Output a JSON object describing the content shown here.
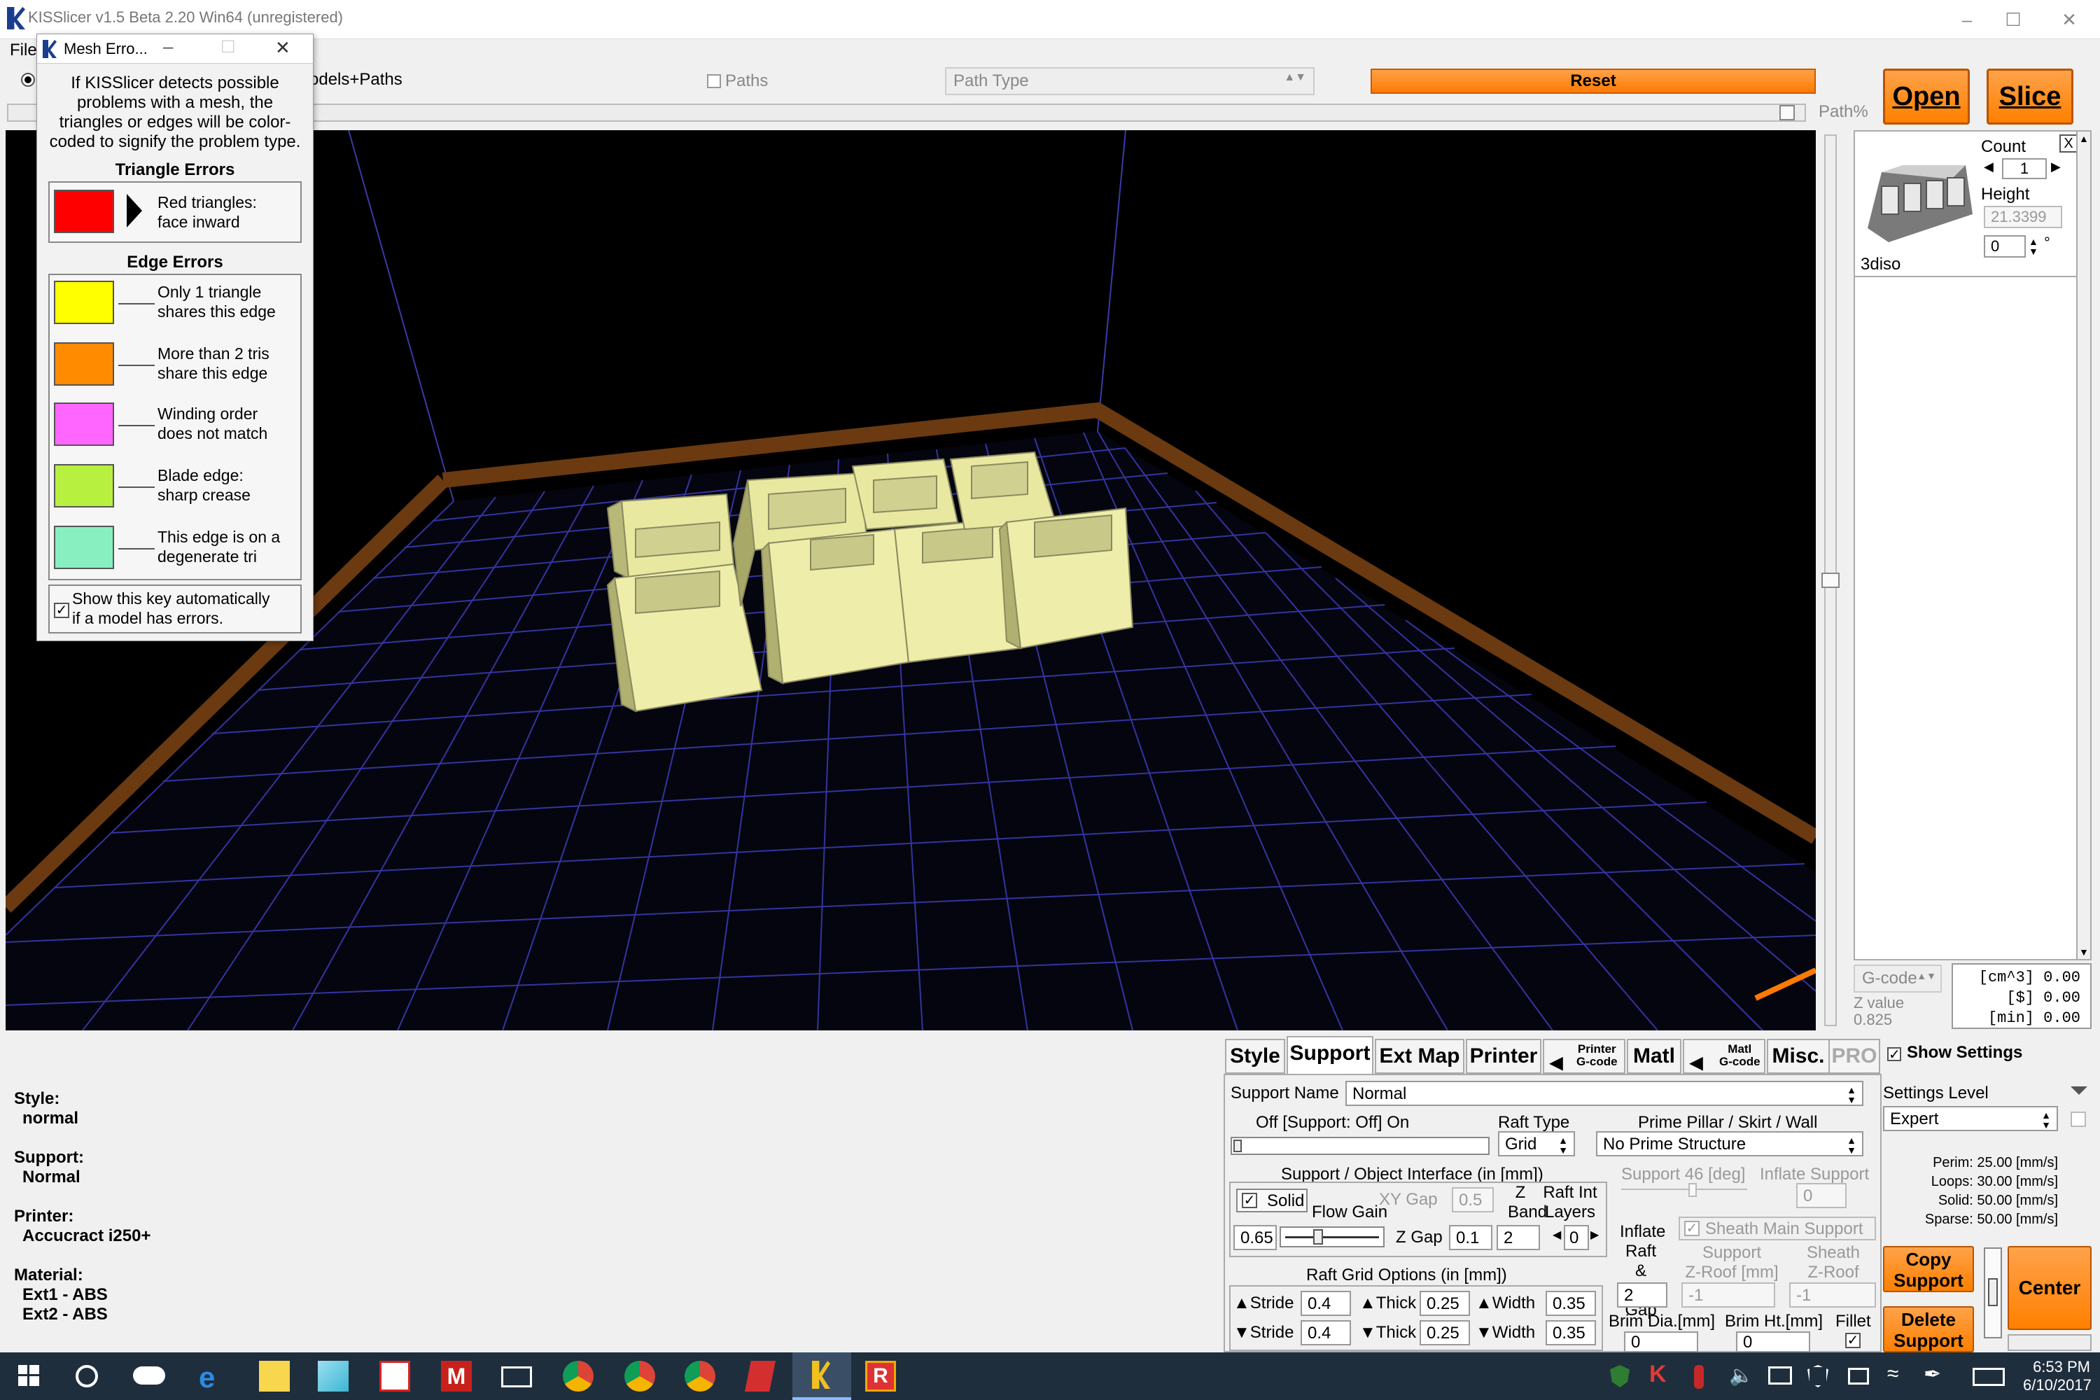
{
  "window": {
    "title": "KISSlicer v1.5 Beta 2.20 Win64 (unregistered)"
  },
  "menu": {
    "file": "File"
  },
  "toolbar": {
    "models_paths": "odels+Paths",
    "paths_label": "Paths",
    "path_type": "Path Type",
    "reset": "Reset",
    "path_pct": "Path%",
    "open": "Open",
    "slice": "Slice"
  },
  "mesh_dialog": {
    "title": "Mesh Erro...",
    "intro": [
      "If KISSlicer detects possible",
      "problems with a mesh, the",
      "triangles or edges will be color-",
      "coded to signify the problem type."
    ],
    "triangle_errors_title": "Triangle Errors",
    "edge_errors_title": "Edge Errors",
    "items": [
      {
        "color": "#ff0000",
        "l1": "Red triangles:",
        "l2": "face inward"
      },
      {
        "color": "#ffff00",
        "l1": "Only 1 triangle",
        "l2": "shares this edge"
      },
      {
        "color": "#ff8c00",
        "l1": "More than 2 tris",
        "l2": "share this edge"
      },
      {
        "color": "#ff66ff",
        "l1": "Winding order",
        "l2": "does not match"
      },
      {
        "color": "#b8f040",
        "l1": "Blade edge:",
        "l2": "sharp crease"
      },
      {
        "color": "#88f0c0",
        "l1": "This edge is on a",
        "l2": "degenerate tri"
      }
    ],
    "show_key_l1": "Show this key automatically",
    "show_key_l2": "if a model has errors."
  },
  "model_panel": {
    "count_label": "Count",
    "count_value": "1",
    "height_label": "Height",
    "height_value": "21.3399",
    "rotation_value": "0",
    "deg": "°",
    "model_name": "3diso",
    "close": "X"
  },
  "zpanel": {
    "gcode": "G-code",
    "z_value_label": "Z value",
    "z_value": "0.825",
    "cm3": "[cm^3] 0.00",
    "dollar": "[$] 0.00",
    "min": "[min] 0.00"
  },
  "status": {
    "style_label": "Style:",
    "style_value": "normal",
    "support_label": "Support:",
    "support_value": "Normal",
    "printer_label": "Printer:",
    "printer_value": "Accucract i250+",
    "material_label": "Material:",
    "ext1": "Ext1 - ABS",
    "ext2": "Ext2 - ABS"
  },
  "tabs": {
    "style": "Style",
    "support": "Support",
    "ext_map": "Ext Map",
    "printer": "Printer",
    "printer_gcode_1": "Printer",
    "printer_gcode_2": "G-code",
    "matl": "Matl",
    "matl_gcode_1": "Matl",
    "matl_gcode_2": "G-code",
    "misc": "Misc.",
    "pro": "PRO"
  },
  "support_settings": {
    "support_name_label": "Support Name",
    "support_name_value": "Normal",
    "off_on": "Off [Support: Off] On",
    "raft_type_label": "Raft Type",
    "raft_type_value": "Grid",
    "prime_pillar_label": "Prime Pillar / Skirt /  Wall",
    "prime_pillar_value": "No Prime Structure",
    "interface_label": "Support / Object Interface (in [mm])",
    "support_deg": "Support 46 [deg]",
    "inflate_support": "Inflate Support",
    "inflate_support_value": "0",
    "solid": "Solid",
    "xy_gap": "XY Gap",
    "xy_gap_value": "0.5",
    "z_band_1": "Z",
    "z_band_2": "Band",
    "raft_int_1": "Raft Int",
    "raft_int_2": "Layers",
    "flow_gain": "Flow Gain",
    "flow_gain_value": "0.65",
    "z_gap": "Z Gap",
    "z_gap_value": "0.1",
    "z_band_value": "2",
    "raft_layers_value": "0",
    "sheath_main": "Sheath Main Support",
    "inflate_raft_1": "Inflate",
    "inflate_raft_2": "Raft &",
    "inflate_raft_3": "Prime Gap",
    "inflate_raft_value": "2",
    "support_zroof_1": "Support",
    "support_zroof_2": "Z-Roof [mm]",
    "support_zroof_value": "-1",
    "sheath_zroof_1": "Sheath",
    "sheath_zroof_2": "Z-Roof [mm]",
    "sheath_zroof_value": "-1",
    "raft_grid_label": "Raft Grid Options (in [mm])",
    "stride": "Stride",
    "thick": "Thick",
    "width": "Width",
    "stride_1": "0.4",
    "thick_1": "0.25",
    "width_1": "0.35",
    "stride_2": "0.4",
    "thick_2": "0.25",
    "width_2": "0.35",
    "brim_dia": "Brim Dia.[mm]",
    "brim_dia_value": "0",
    "brim_ht": "Brim Ht.[mm]",
    "brim_ht_value": "0",
    "fillet": "Fillet"
  },
  "side_settings": {
    "show_settings": "Show Settings",
    "settings_level_label": "Settings Level",
    "settings_level_value": "Expert",
    "perim": "Perim:  25.00 [mm/s]",
    "loops": "Loops:  30.00 [mm/s]",
    "solid": "Solid:  50.00 [mm/s]",
    "sparse": "Sparse: 50.00 [mm/s]",
    "copy_support_1": "Copy",
    "copy_support_2": "Support",
    "delete_support_1": "Delete",
    "delete_support_2": "Support",
    "center": "Center"
  },
  "taskbar": {
    "time": "6:53 PM",
    "date": "6/10/2017"
  }
}
